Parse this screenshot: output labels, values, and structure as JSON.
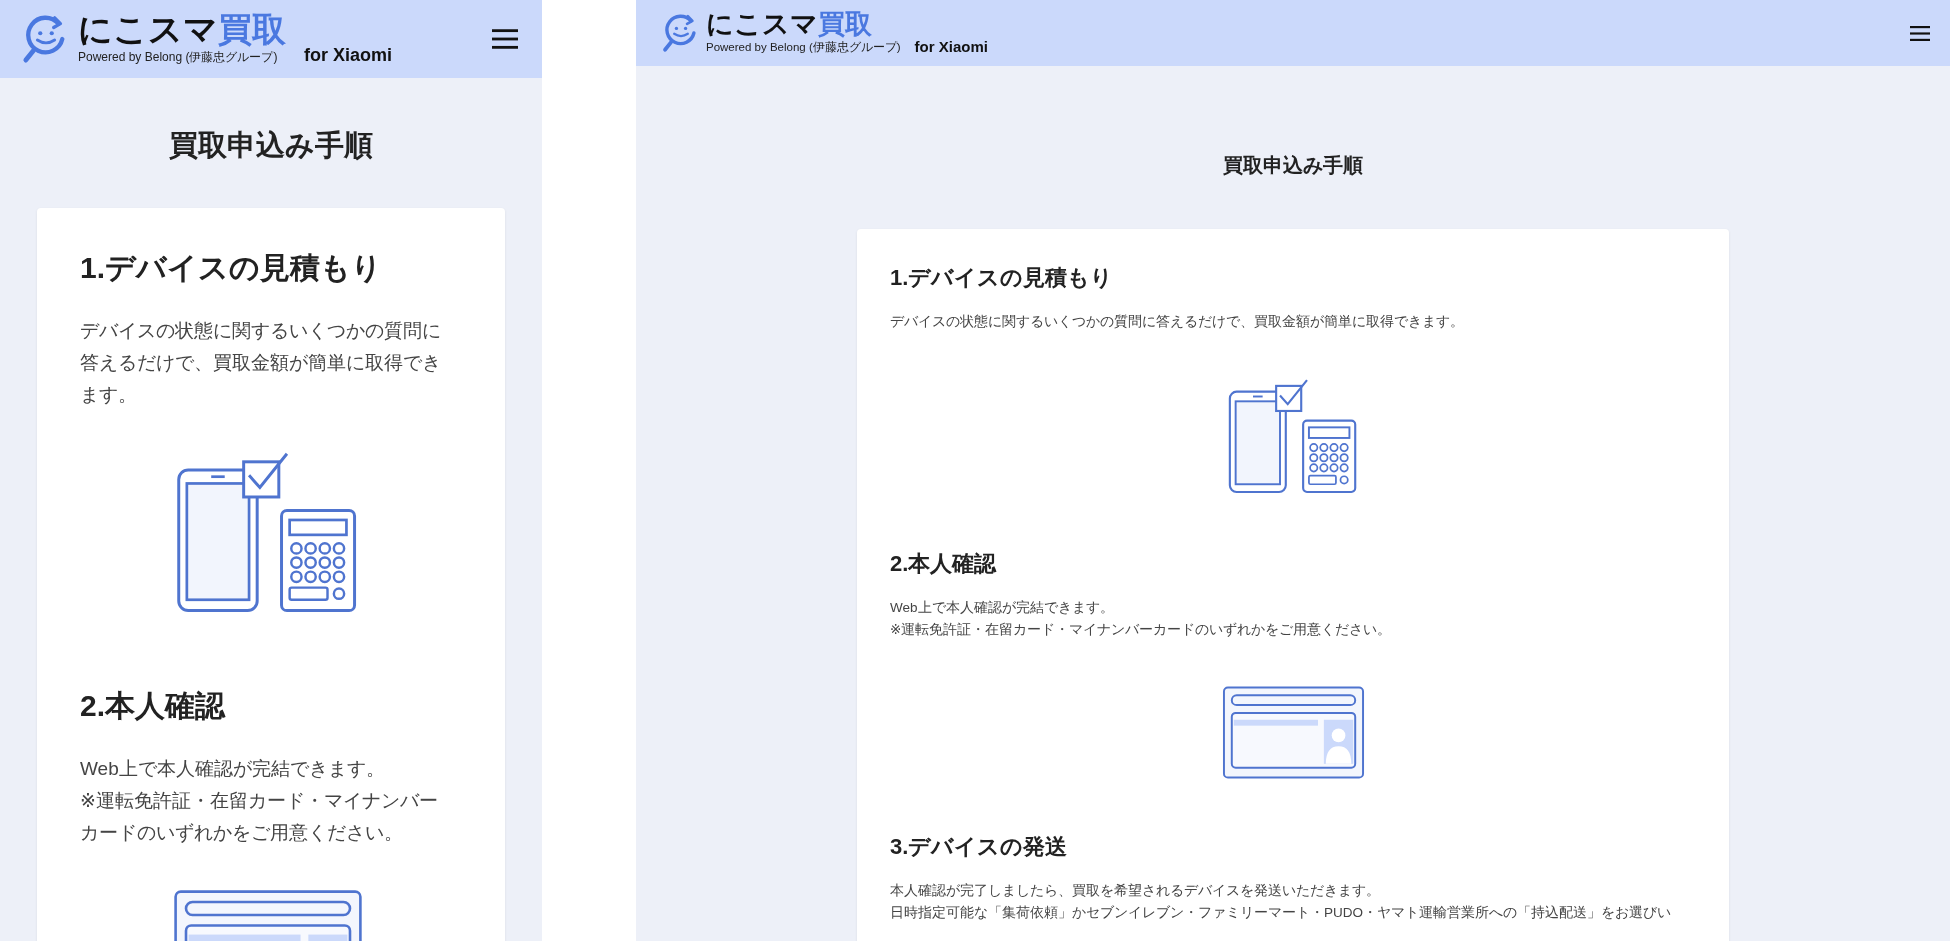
{
  "views": [
    {
      "kind": "mobile",
      "header": {
        "logo_main": "にこスマ",
        "logo_accent": "買取",
        "tagline": "Powered by Belong (伊藤忠グループ)",
        "brand_suffix": "for Xiaomi"
      },
      "page_title": "買取申込み手順",
      "steps": [
        {
          "kind": "estimate",
          "title": "1.デバイスの見積もり",
          "paragraphs": [
            "デバイスの状態に関するいくつかの質問に答えるだけで、買取金額が簡単に取得できます。"
          ]
        },
        {
          "kind": "id-card",
          "title": "2.本人確認",
          "paragraphs": [
            "Web上で本人確認が完結できます。",
            "※運転免許証・在留カード・マイナンバーカードのいずれかをご用意ください。"
          ]
        }
      ]
    },
    {
      "kind": "desktop",
      "header": {
        "logo_main": "にこスマ",
        "logo_accent": "買取",
        "tagline": "Powered by Belong (伊藤忠グループ)",
        "brand_suffix": "for Xiaomi"
      },
      "page_title": "買取申込み手順",
      "steps": [
        {
          "kind": "estimate",
          "title": "1.デバイスの見積もり",
          "paragraphs": [
            "デバイスの状態に関するいくつかの質問に答えるだけで、買取金額が簡単に取得できます。"
          ]
        },
        {
          "kind": "id-card",
          "title": "2.本人確認",
          "paragraphs": [
            "Web上で本人確認が完結できます。",
            "※運転免許証・在留カード・マイナンバーカードのいずれかをご用意ください。"
          ]
        },
        {
          "kind": "text",
          "title": "3.デバイスの発送",
          "paragraphs": [
            "本人確認が完了しましたら、買取を希望されるデバイスを発送いただきます。",
            "日時指定可能な「集荷依頼」かセブンイレブン・ファミリーマート・PUDO・ヤマト運輸営業所への「持込配送」をお選びい"
          ]
        }
      ]
    }
  ]
}
